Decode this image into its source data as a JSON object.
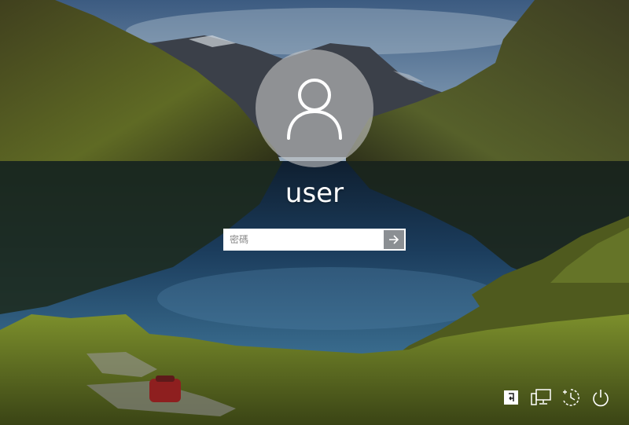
{
  "user": {
    "name": "user"
  },
  "password": {
    "placeholder": "密碼",
    "value": ""
  },
  "buttons": {
    "submit": "submit-arrow-icon",
    "ime": "ime-switch-icon",
    "network": "network-icon",
    "accessibility": "accessibility-icon",
    "power": "power-icon"
  },
  "colors": {
    "text": "#ffffff",
    "avatar_circle": "#c3c3c3",
    "submit_button": "#6e7378"
  }
}
